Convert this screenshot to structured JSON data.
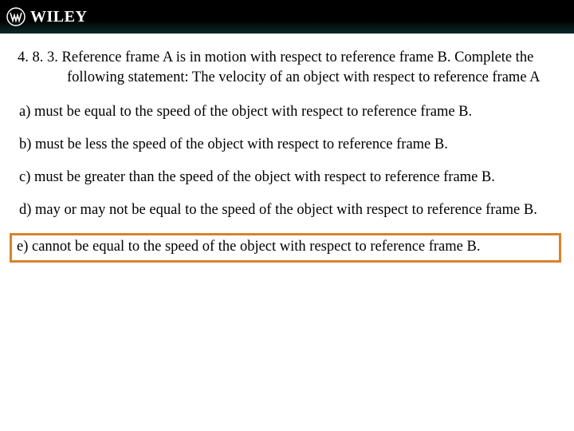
{
  "brand": "WILEY",
  "question": {
    "number": "4. 8. 3.",
    "text": "Reference frame A is in motion with respect to reference frame B. Complete the following statement: The velocity of an object with respect to reference frame A"
  },
  "options": {
    "a": {
      "label": "a)",
      "text": "must be equal to the speed of the object with respect to reference frame B."
    },
    "b": {
      "label": "b)",
      "text": "must be less the speed of the object with respect to reference frame B."
    },
    "c": {
      "label": "c)",
      "text": "must be greater than the speed of the object with respect to reference frame B."
    },
    "d": {
      "label": "d)",
      "text": "may or may not be equal to the speed of the object with respect to reference frame B."
    },
    "e": {
      "label": "e)",
      "text": "cannot be equal to the speed of the object with respect to reference frame B."
    }
  },
  "selected": "e"
}
